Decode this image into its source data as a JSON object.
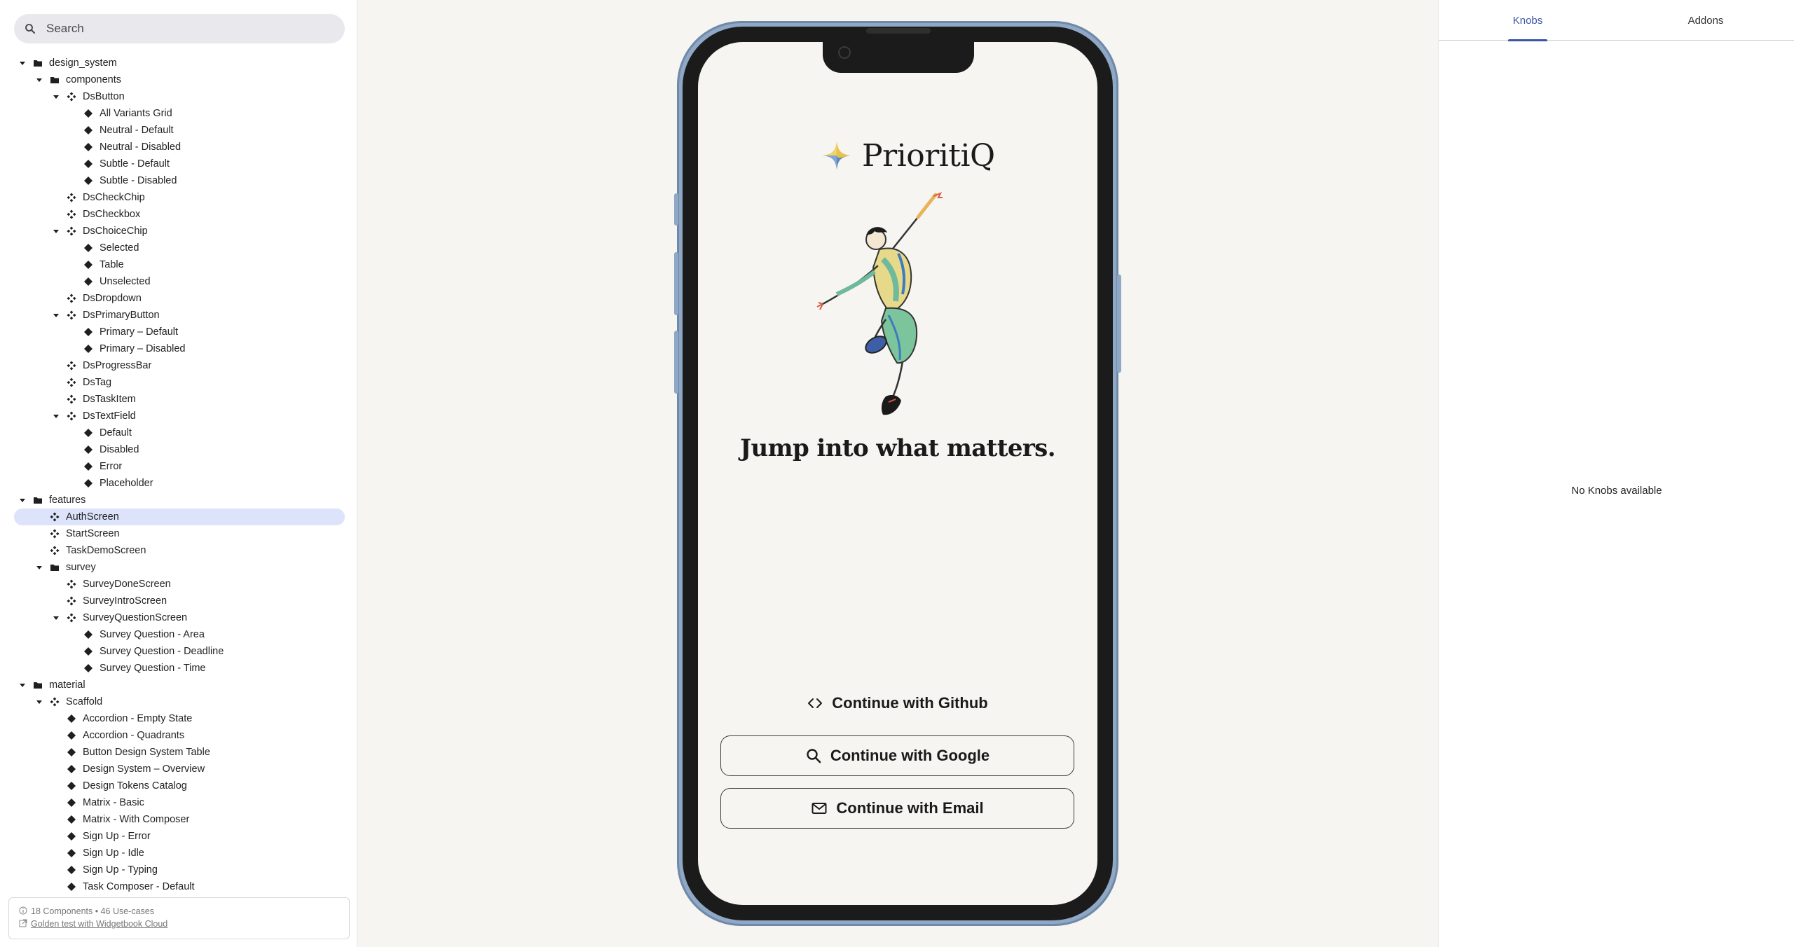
{
  "search": {
    "placeholder": "Search"
  },
  "tree": [
    {
      "label": "design_system",
      "type": "folder",
      "level": 0,
      "expanded": true
    },
    {
      "label": "components",
      "type": "folder",
      "level": 1,
      "expanded": true
    },
    {
      "label": "DsButton",
      "type": "component",
      "level": 2,
      "expanded": true
    },
    {
      "label": "All Variants Grid",
      "type": "usecase",
      "level": 3
    },
    {
      "label": "Neutral - Default",
      "type": "usecase",
      "level": 3
    },
    {
      "label": "Neutral - Disabled",
      "type": "usecase",
      "level": 3
    },
    {
      "label": "Subtle - Default",
      "type": "usecase",
      "level": 3
    },
    {
      "label": "Subtle - Disabled",
      "type": "usecase",
      "level": 3
    },
    {
      "label": "DsCheckChip",
      "type": "component",
      "level": 2
    },
    {
      "label": "DsCheckbox",
      "type": "component",
      "level": 2
    },
    {
      "label": "DsChoiceChip",
      "type": "component",
      "level": 2,
      "expanded": true
    },
    {
      "label": "Selected",
      "type": "usecase",
      "level": 3
    },
    {
      "label": "Table",
      "type": "usecase",
      "level": 3
    },
    {
      "label": "Unselected",
      "type": "usecase",
      "level": 3
    },
    {
      "label": "DsDropdown",
      "type": "component",
      "level": 2
    },
    {
      "label": "DsPrimaryButton",
      "type": "component",
      "level": 2,
      "expanded": true
    },
    {
      "label": "Primary – Default",
      "type": "usecase",
      "level": 3
    },
    {
      "label": "Primary – Disabled",
      "type": "usecase",
      "level": 3
    },
    {
      "label": "DsProgressBar",
      "type": "component",
      "level": 2
    },
    {
      "label": "DsTag",
      "type": "component",
      "level": 2
    },
    {
      "label": "DsTaskItem",
      "type": "component",
      "level": 2
    },
    {
      "label": "DsTextField",
      "type": "component",
      "level": 2,
      "expanded": true
    },
    {
      "label": "Default",
      "type": "usecase",
      "level": 3
    },
    {
      "label": "Disabled",
      "type": "usecase",
      "level": 3
    },
    {
      "label": "Error",
      "type": "usecase",
      "level": 3
    },
    {
      "label": "Placeholder",
      "type": "usecase",
      "level": 3
    },
    {
      "label": "features",
      "type": "folder",
      "level": 0,
      "expanded": true
    },
    {
      "label": "AuthScreen",
      "type": "component",
      "level": 1,
      "selected": true
    },
    {
      "label": "StartScreen",
      "type": "component",
      "level": 1
    },
    {
      "label": "TaskDemoScreen",
      "type": "component",
      "level": 1
    },
    {
      "label": "survey",
      "type": "folder",
      "level": 1,
      "expanded": true
    },
    {
      "label": "SurveyDoneScreen",
      "type": "component",
      "level": 2
    },
    {
      "label": "SurveyIntroScreen",
      "type": "component",
      "level": 2
    },
    {
      "label": "SurveyQuestionScreen",
      "type": "component",
      "level": 2,
      "expanded": true
    },
    {
      "label": "Survey Question - Area",
      "type": "usecase",
      "level": 3
    },
    {
      "label": "Survey Question - Deadline",
      "type": "usecase",
      "level": 3
    },
    {
      "label": "Survey Question - Time",
      "type": "usecase",
      "level": 3
    },
    {
      "label": "material",
      "type": "folder",
      "level": 0,
      "expanded": true
    },
    {
      "label": "Scaffold",
      "type": "component",
      "level": 1,
      "expanded": true
    },
    {
      "label": "Accordion - Empty State",
      "type": "usecase",
      "level": 2
    },
    {
      "label": "Accordion - Quadrants",
      "type": "usecase",
      "level": 2
    },
    {
      "label": "Button Design System Table",
      "type": "usecase",
      "level": 2
    },
    {
      "label": "Design System – Overview",
      "type": "usecase",
      "level": 2
    },
    {
      "label": "Design Tokens Catalog",
      "type": "usecase",
      "level": 2
    },
    {
      "label": "Matrix - Basic",
      "type": "usecase",
      "level": 2
    },
    {
      "label": "Matrix - With Composer",
      "type": "usecase",
      "level": 2
    },
    {
      "label": "Sign Up - Error",
      "type": "usecase",
      "level": 2
    },
    {
      "label": "Sign Up - Idle",
      "type": "usecase",
      "level": 2
    },
    {
      "label": "Sign Up - Typing",
      "type": "usecase",
      "level": 2
    },
    {
      "label": "Task Composer - Default",
      "type": "usecase",
      "level": 2
    }
  ],
  "footer": {
    "stats": "18 Components • 46 Use-cases",
    "link": "Golden test with Widgetbook Cloud"
  },
  "right_panel": {
    "tabs": [
      {
        "label": "Knobs",
        "active": true
      },
      {
        "label": "Addons",
        "active": false
      }
    ],
    "empty_message": "No Knobs available"
  },
  "screen": {
    "brand_name": "PrioritiQ",
    "tagline": "Jump into what matters.",
    "github_label": "Continue with Github",
    "google_label": "Continue with Google",
    "email_label": "Continue with Email"
  },
  "colors": {
    "selected_row": "#dde3fb",
    "accent": "#3a55a8",
    "phone_frame": "#8fa8c5",
    "screen_bg": "#f7f5f1"
  }
}
